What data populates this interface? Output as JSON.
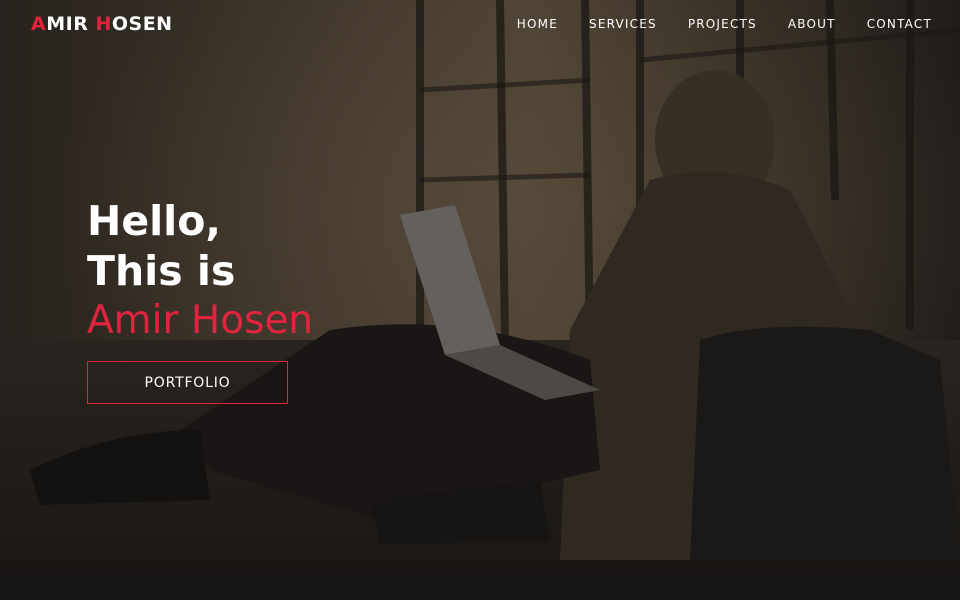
{
  "logo": {
    "first_initial": "A",
    "first_rest": "MIR ",
    "last_initial": "H",
    "last_rest": "OSEN"
  },
  "nav": {
    "items": [
      {
        "label": "HOME"
      },
      {
        "label": "SERVICES"
      },
      {
        "label": "PROJECTS"
      },
      {
        "label": "ABOUT"
      },
      {
        "label": "CONTACT"
      }
    ]
  },
  "hero": {
    "greeting": "Hello,",
    "intro": "This is",
    "name": "Amir Hosen",
    "button_label": "PORTFOLIO"
  },
  "colors": {
    "accent": "#e0243e",
    "text": "#ffffff",
    "overlay": "#1a1816"
  }
}
